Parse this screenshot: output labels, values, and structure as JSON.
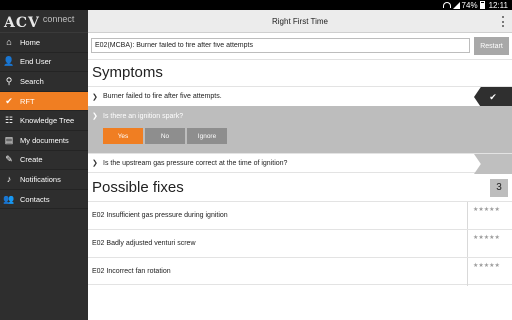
{
  "status": {
    "battery": "74%",
    "time": "12:11"
  },
  "app": {
    "logo_main": "ACV",
    "logo_sub": "connect",
    "title": "Right First Time"
  },
  "sidebar": {
    "items": [
      {
        "label": "Home",
        "icon": "home-icon",
        "glyph": "⌂",
        "active": false
      },
      {
        "label": "End User",
        "icon": "user-icon",
        "glyph": "👤",
        "active": false
      },
      {
        "label": "Search",
        "icon": "search-icon",
        "glyph": "⚲",
        "active": false
      },
      {
        "label": "RFT",
        "icon": "checkmark-icon",
        "glyph": "✔",
        "active": true
      },
      {
        "label": "Knowledge Tree",
        "icon": "tree-icon",
        "glyph": "☷",
        "active": false
      },
      {
        "label": "My documents",
        "icon": "document-icon",
        "glyph": "▤",
        "active": false
      },
      {
        "label": "Create",
        "icon": "pencil-icon",
        "glyph": "✎",
        "active": false
      },
      {
        "label": "Notifications",
        "icon": "bell-icon",
        "glyph": "♪",
        "active": false
      },
      {
        "label": "Contacts",
        "icon": "contacts-icon",
        "glyph": "👥",
        "active": false
      }
    ]
  },
  "search": {
    "value": "E02(MCBA): Burner failed to fire after five attempts",
    "restart_label": "Restart"
  },
  "symptoms": {
    "title": "Symptoms",
    "rows": [
      {
        "text": "Burner failed to fire after five attempts."
      },
      {
        "text": "Is there an ignition spark?",
        "answers": [
          "Yes",
          "No",
          "Ignore"
        ],
        "selected": "Yes"
      },
      {
        "text": "Is the upstream gas pressure correct at the time of ignition?"
      }
    ]
  },
  "fixes": {
    "title": "Possible fixes",
    "count": "3",
    "items": [
      {
        "text": "E02 Insufficient gas pressure during ignition",
        "stars": "★★★★★"
      },
      {
        "text": "E02 Badly adjusted venturi screw",
        "stars": "★★★★★"
      },
      {
        "text": "E02 Incorrect fan rotation",
        "stars": "★★★★★"
      }
    ]
  },
  "colors": {
    "accent": "#f07e22",
    "sidebar": "#2e2e2e",
    "dark_tail": "#2f2f2f"
  }
}
